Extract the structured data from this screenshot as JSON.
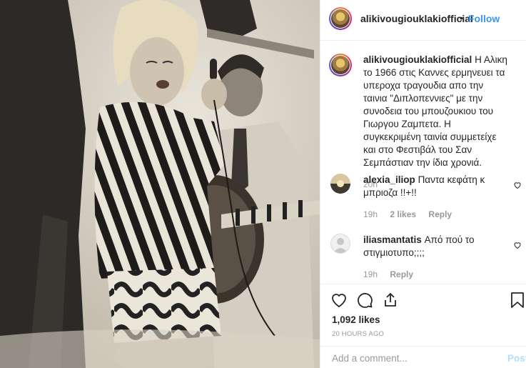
{
  "post": {
    "image_alt": "Vintage black and white photograph of a blonde woman singing into a microphone with a guitarist behind her"
  },
  "header": {
    "username": "alikivougiouklakiofficial",
    "dot": "•",
    "follow_label": "Follow",
    "menu_label": "···"
  },
  "caption": {
    "username": "alikivougiouklakiofficial",
    "text": "Η Αλικη το 1966 στις Καννες ερμηνευει τα υπεροχα τραγουδια απο την ταινια \"Διπλοπεννιες\" με την συνοδεια του μπουζουκιου του Γιωργου Ζαμπετα. Η συγκεκριμένη ταινία συμμετείχε και στο Φεστιβάλ του Σαν Σεμπάστιαν την ίδια χρονιά.",
    "time": "20h"
  },
  "comments": [
    {
      "username": "alexia_iliop",
      "text": "Παντα κεφάτη κ μπριοζα !!+!!",
      "time": "19h",
      "likes": "2 likes",
      "reply": "Reply"
    },
    {
      "username": "iliasmantatis",
      "text": "Από πού το στιγμιοτυπο;;;;",
      "time": "19h",
      "reply": "Reply"
    }
  ],
  "stats": {
    "likes": "1,092 likes",
    "timestamp": "20 HOURS AGO"
  },
  "composer": {
    "placeholder": "Add a comment...",
    "post_label": "Post"
  },
  "colors": {
    "accent": "#3897f0",
    "post_disabled": "#b3dbff",
    "muted": "#999999"
  }
}
